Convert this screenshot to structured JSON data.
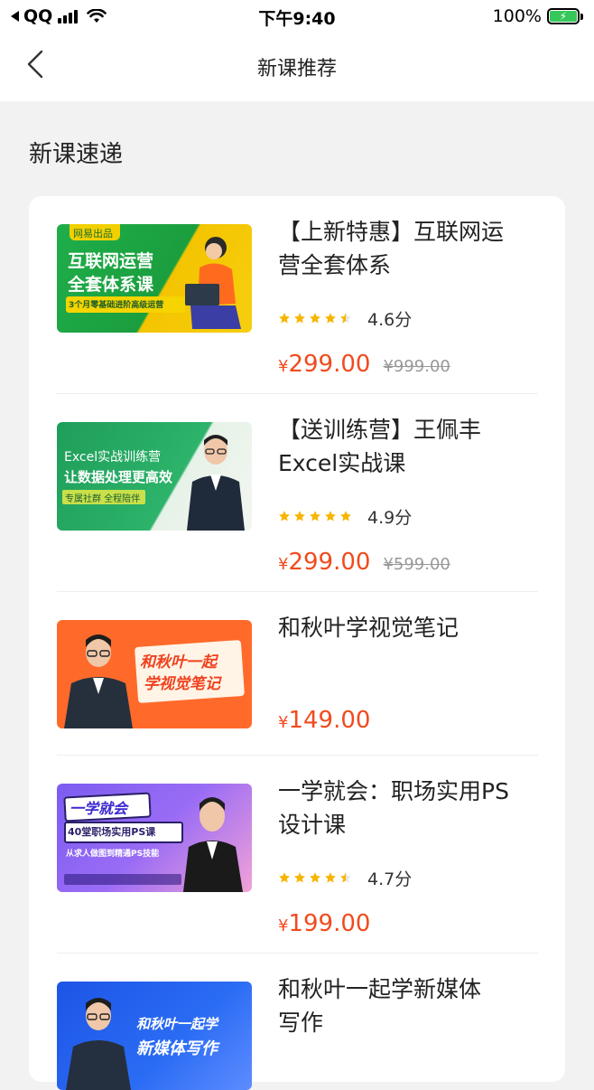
{
  "status_bar": {
    "carrier": "QQ",
    "time": "下午9:40",
    "battery": "100%"
  },
  "nav": {
    "title": "新课推荐"
  },
  "section": {
    "title": "新课速递"
  },
  "courses": [
    {
      "title_line1": "【上新特惠】互联网运",
      "title_line2": "营全套体系",
      "rating": "4.6分",
      "stars": 4.5,
      "price": "299.00",
      "original_price": "¥999.00",
      "thumb": {
        "badge": "网易出品",
        "line1": "互联网运营",
        "line2": "全套体系课",
        "sub": "3个月零基础进阶高级运营"
      }
    },
    {
      "title_line1": "【送训练营】王佩丰",
      "title_line2": "Excel实战课",
      "rating": "4.9分",
      "stars": 5,
      "price": "299.00",
      "original_price": "¥599.00",
      "thumb": {
        "line1": "Excel实战训练营",
        "line2": "让数据处理更高效",
        "sub": "专属社群 全程陪伴"
      }
    },
    {
      "title_line1": "和秋叶学视觉笔记",
      "title_line2": "",
      "price": "149.00",
      "thumb": {
        "line1": "和秋叶一起",
        "line2": "学视觉笔记"
      }
    },
    {
      "title_line1": "一学就会：职场实用PS",
      "title_line2": "设计课",
      "rating": "4.7分",
      "stars": 4.5,
      "price": "199.00",
      "thumb": {
        "line1": "一学就会",
        "line2": "40堂职场实用PS课",
        "sub": "从求人做图到精通PS技能"
      }
    },
    {
      "title_line1": "和秋叶一起学新媒体",
      "title_line2": "写作",
      "thumb": {
        "line1": "和秋叶一起学",
        "line2": "新媒体写作"
      }
    }
  ],
  "colors": {
    "price": "#f04b1e",
    "star": "#f7b500",
    "battery": "#35c759"
  }
}
